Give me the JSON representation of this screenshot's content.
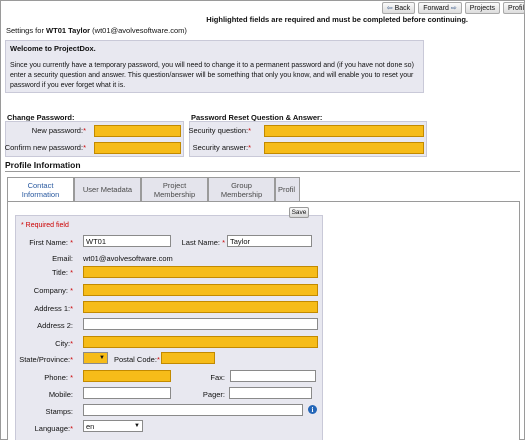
{
  "nav": {
    "back": "Back",
    "forward": "Forward",
    "projects": "Projects",
    "profile": "Profil"
  },
  "notice": "Highlighted fields are required and must be completed before continuing.",
  "settings": {
    "prefix": "Settings for",
    "user": "WT01 Taylor",
    "email": "(wt01@avolvesoftware.com)"
  },
  "welcome": {
    "title": "Welcome to ProjectDox.",
    "text": "Since you currently have a temporary password, you will need to change it to a permanent password and (if you have not done so) enter a security question and answer. This question/answer will be something that only you know, and will enable you to reset your password if you ever forget what it is."
  },
  "change_password": {
    "title": "Change Password:",
    "new_label": "New password:",
    "confirm_label": "Confirm new password:",
    "new_value": "",
    "confirm_value": ""
  },
  "reset": {
    "title": "Password Reset Question & Answer:",
    "question_label": "Security question:",
    "answer_label": "Security answer:",
    "question_value": "",
    "answer_value": ""
  },
  "profile": {
    "title": "Profile Information",
    "tabs": [
      {
        "label": "Contact Information"
      },
      {
        "label": "User Metadata"
      },
      {
        "label": "Project Membership"
      },
      {
        "label": "Group Membership"
      },
      {
        "label": "Profil"
      }
    ],
    "save": "Save",
    "required_note": "* Required field",
    "fields": {
      "first_name_label": "First Name:",
      "first_name": "WT01",
      "last_name_label": "Last Name:",
      "last_name": "Taylor",
      "email_label": "Email:",
      "email": "wt01@avolvesoftware.com",
      "title_label": "Title:",
      "company_label": "Company:",
      "address1_label": "Address 1:",
      "address2_label": "Address 2:",
      "city_label": "City:",
      "state_label": "State/Province:",
      "postal_label": "Postal Code:",
      "phone_label": "Phone:",
      "fax_label": "Fax:",
      "mobile_label": "Mobile:",
      "pager_label": "Pager:",
      "stamps_label": "Stamps:",
      "language_label": "Language:",
      "language": "en",
      "star": "*"
    }
  },
  "colors": {
    "required_highlight": "#f6bc19",
    "panel_bg": "#e8e8f0",
    "active_tab_text": "#2a5aa0",
    "required_text": "#cc0000"
  }
}
